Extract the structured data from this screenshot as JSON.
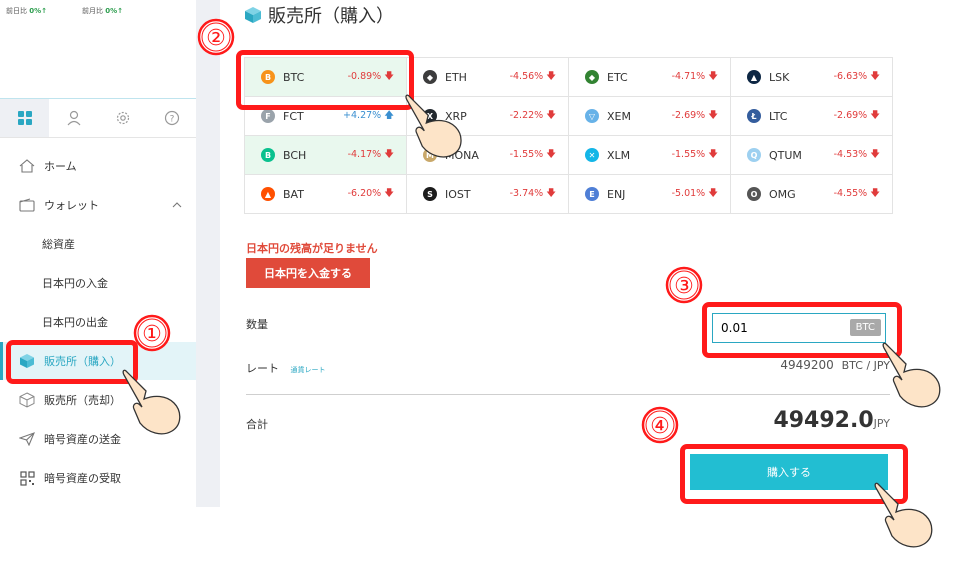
{
  "sidebar": {
    "stats": {
      "day_label": "前日比",
      "day_value": "0%↑",
      "month_label": "前月比",
      "month_value": "0%↑"
    },
    "tabs": [
      "grid-icon",
      "user-icon",
      "gear-icon",
      "help-icon"
    ],
    "items": [
      {
        "label": "ホーム",
        "icon": "home-icon"
      },
      {
        "label": "ウォレット",
        "icon": "wallet-icon"
      },
      {
        "label": "総資産"
      },
      {
        "label": "日本円の入金"
      },
      {
        "label": "日本円の出金"
      },
      {
        "label": "販売所（購入）",
        "icon": "cube-icon",
        "active": true
      },
      {
        "label": "販売所（売却）",
        "icon": "cube-outline-icon"
      },
      {
        "label": "暗号資産の送金",
        "icon": "send-icon"
      },
      {
        "label": "暗号資産の受取",
        "icon": "qr-icon"
      }
    ]
  },
  "main": {
    "title": "販売所（購入）",
    "coins": [
      [
        {
          "name": "BTC",
          "change": "-0.89%",
          "dir": "down",
          "color": "#f7931a",
          "glyph": "B"
        },
        {
          "name": "ETH",
          "change": "-4.56%",
          "dir": "down",
          "color": "#3c3c3d",
          "glyph": "◆"
        },
        {
          "name": "ETC",
          "change": "-4.71%",
          "dir": "down",
          "color": "#328332",
          "glyph": "◆"
        },
        {
          "name": "LSK",
          "change": "-6.63%",
          "dir": "down",
          "color": "#0d2744",
          "glyph": "▲"
        }
      ],
      [
        {
          "name": "FCT",
          "change": "+4.27%",
          "dir": "up",
          "color": "#9aa3ab",
          "glyph": "F"
        },
        {
          "name": "XRP",
          "change": "-2.22%",
          "dir": "down",
          "color": "#23292f",
          "glyph": "X"
        },
        {
          "name": "XEM",
          "change": "-2.69%",
          "dir": "down",
          "color": "#67b2e8",
          "glyph": "▽"
        },
        {
          "name": "LTC",
          "change": "-2.69%",
          "dir": "down",
          "color": "#345d9d",
          "glyph": "Ł"
        }
      ],
      [
        {
          "name": "BCH",
          "change": "-4.17%",
          "dir": "down",
          "color": "#0ac18e",
          "glyph": "B"
        },
        {
          "name": "MONA",
          "change": "-1.55%",
          "dir": "down",
          "color": "#c9a86a",
          "glyph": "M"
        },
        {
          "name": "XLM",
          "change": "-1.55%",
          "dir": "down",
          "color": "#14b6e7",
          "glyph": "✕"
        },
        {
          "name": "QTUM",
          "change": "-4.53%",
          "dir": "down",
          "color": "#9dd0f0",
          "glyph": "Q"
        }
      ],
      [
        {
          "name": "BAT",
          "change": "-6.20%",
          "dir": "down",
          "color": "#ff5000",
          "glyph": "▲"
        },
        {
          "name": "IOST",
          "change": "-3.74%",
          "dir": "down",
          "color": "#1c1c1c",
          "glyph": "S"
        },
        {
          "name": "ENJ",
          "change": "-5.01%",
          "dir": "down",
          "color": "#4f7fd6",
          "glyph": "E"
        },
        {
          "name": "OMG",
          "change": "-4.55%",
          "dir": "down",
          "color": "#555555",
          "glyph": "O"
        }
      ]
    ],
    "warning": "日本円の残高が足りません",
    "deposit_button": "日本円を入金する",
    "quantity_label": "数量",
    "quantity_value": "0.01",
    "quantity_unit": "BTC",
    "rate_label": "レート",
    "rate_link": "通貨レート",
    "rate_value": "4949200",
    "rate_unit": "BTC / JPY",
    "total_label": "合計",
    "total_value": "49492.0",
    "total_unit": "JPY",
    "buy_button": "購入する"
  },
  "annotations": [
    "①",
    "②",
    "③",
    "④"
  ],
  "colors": {
    "accent": "#22bed2",
    "highlight": "#ff1a1a",
    "down": "#e03b3b",
    "up": "#3a8fd0",
    "deposit": "#e04a3a"
  }
}
